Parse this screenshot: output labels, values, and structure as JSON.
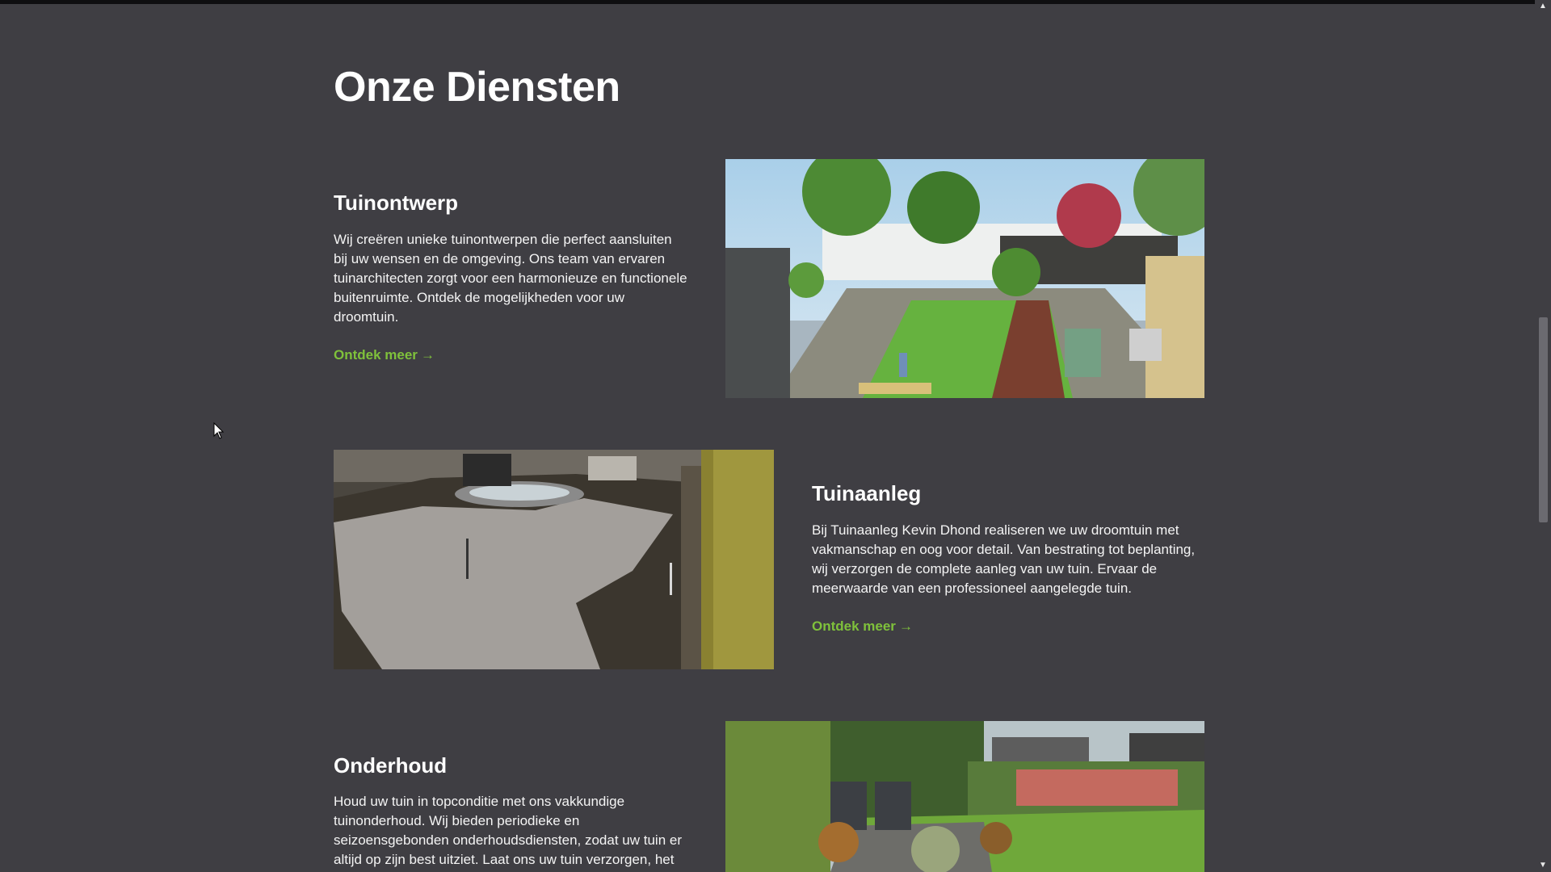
{
  "section": {
    "title": "Onze Diensten"
  },
  "services": [
    {
      "title": "Tuinontwerp",
      "description": "Wij creëren unieke tuinontwerpen die perfect aansluiten bij uw wensen en de omgeving. Ons team van ervaren tuinarchitecten zorgt voor een harmonieuze en functionele buitenruimte. Ontdek de mogelijkheden voor uw droomtuin.",
      "link_label": "Ontdek meer",
      "link_icon": "arrow-right-icon",
      "image": "garden-design-render"
    },
    {
      "title": "Tuinaanleg",
      "description": "Bij Tuinaanleg Kevin Dhond realiseren we uw droomtuin met vakmanschap en oog voor detail. Van bestrating tot beplanting, wij verzorgen de complete aanleg van uw tuin. Ervaar de meerwaarde van een professioneel aangelegde tuin.",
      "link_label": "Ontdek meer",
      "link_icon": "arrow-right-icon",
      "image": "paving-construction-photo"
    },
    {
      "title": "Onderhoud",
      "description": "Houd uw tuin in topconditie met ons vakkundige tuinonderhoud. Wij bieden periodieke en seizoensgebonden onderhoudsdiensten, zodat uw tuin er altijd op zijn best uitziet. Laat ons uw tuin verzorgen, het",
      "image": "maintained-garden-photo"
    }
  ],
  "colors": {
    "background": "#3f3e43",
    "accent_link": "#7fc13b",
    "text": "#ffffff"
  }
}
